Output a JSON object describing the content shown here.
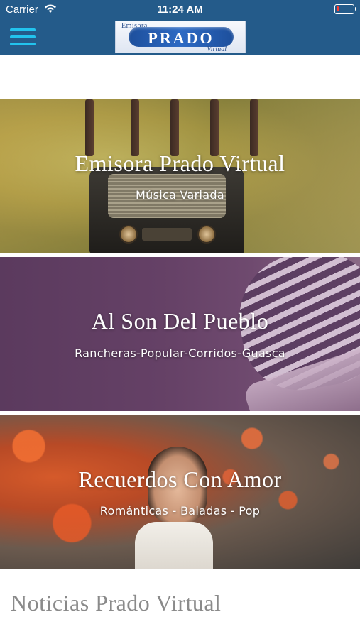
{
  "status_bar": {
    "carrier": "Carrier",
    "time": "11:24 AM",
    "battery_color": "#ff3b30"
  },
  "header": {
    "background_color": "#245b8a",
    "menu_icon": "hamburger-menu-icon",
    "menu_icon_color": "#22c3ee",
    "logo": {
      "top_text": "Emisora",
      "main_text": "PRADO",
      "bottom_text": "Virtual"
    }
  },
  "cards": [
    {
      "title": "Emisora Prado Virtual",
      "subtitle": "Música Variada"
    },
    {
      "title": "Al Son Del Pueblo",
      "subtitle": "Rancheras-Popular-Corridos-Guasca"
    },
    {
      "title": "Recuerdos Con Amor",
      "subtitle": "Románticas - Baladas - Pop"
    }
  ],
  "news_section": {
    "title": "Noticias Prado Virtual"
  }
}
